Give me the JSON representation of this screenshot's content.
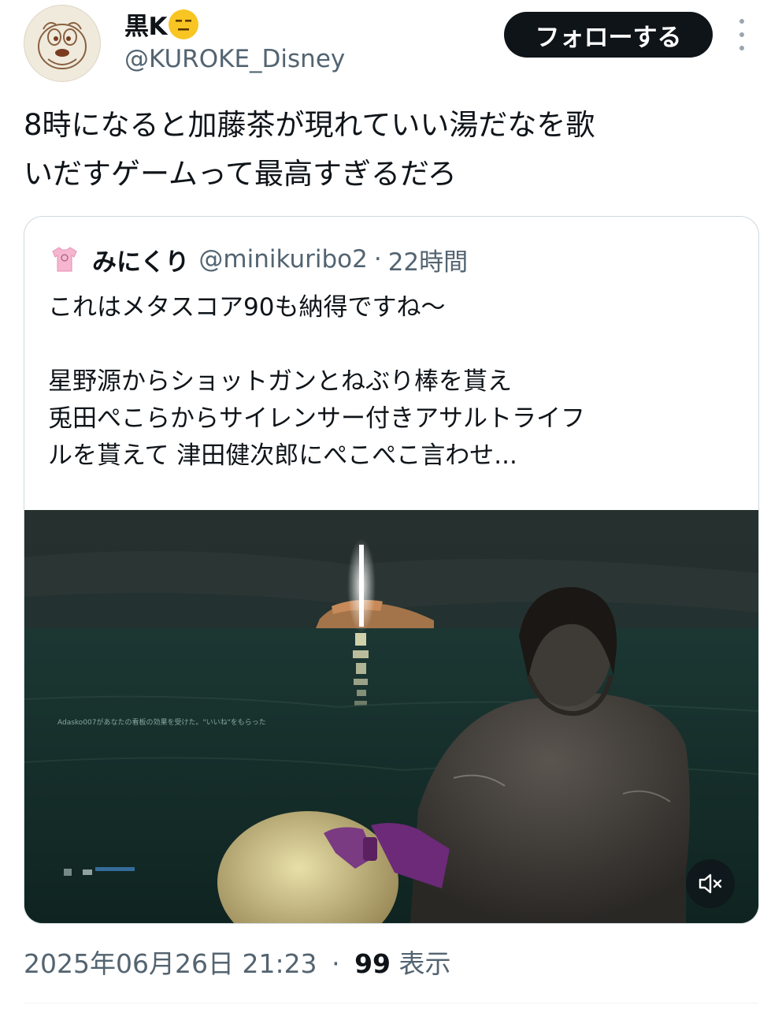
{
  "author": {
    "display_name": "黒K",
    "emoji": "expressionless-face-emoji",
    "handle": "@KUROKE_Disney"
  },
  "follow_label": "フォローする",
  "tweet_text_lines": [
    "8時になると加藤茶が現れていい湯だなを歌",
    "いだすゲームって最高すぎるだろ"
  ],
  "quoted": {
    "display_name": "みにくり",
    "handle": "@minikuribo2",
    "separator": "·",
    "time_ago": "22時間",
    "text_lines": [
      "これはメタスコア90も納得ですね〜",
      "",
      "星野源からショットガンとねぶり棒を貰え",
      "兎田ぺこらからサイレンサー付きアサルトライフ",
      "ルを貰えて 津田健次郎にぺこぺこ言わせ..."
    ],
    "media": {
      "type": "video",
      "game_notification": "Adasko007があなたの看板の効果を受けた。\"いいね\"をもらった",
      "muted": true
    }
  },
  "timestamp": {
    "date": "2025年06月26日 21:23",
    "separator": "·",
    "views_count": "99",
    "views_label": "表示"
  },
  "colors": {
    "text": "#0f1419",
    "secondary": "#536471",
    "follow_bg": "#0f1419",
    "border": "#cfd9de",
    "emoji": "#f9c523",
    "shirt_icon": "#f7b6cf"
  }
}
